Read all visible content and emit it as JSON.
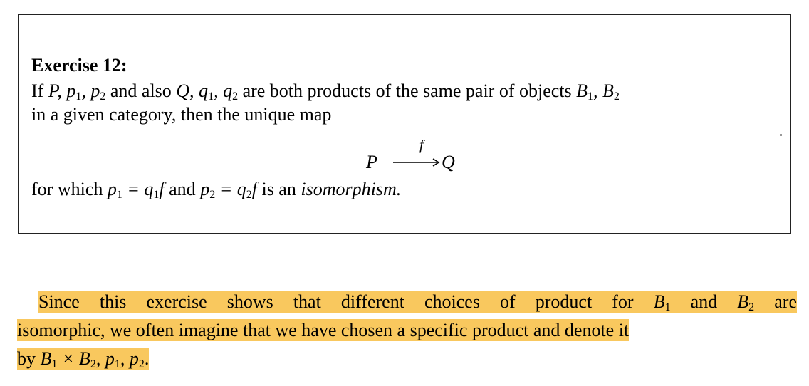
{
  "exercise": {
    "title": "Exercise 12:",
    "line1_a": "If ",
    "line1_b": "P, p",
    "line1_c": ", p",
    "line1_d": " and also ",
    "line1_e": "Q, q",
    "line1_f": ", q",
    "line1_g": " are both products of the same pair of objects ",
    "line1_h": "B",
    "line1_i": ", B",
    "sub1": "1",
    "sub2": "2",
    "line2": "in a given category, then the unique map",
    "map_source": "P",
    "map_label": "f",
    "map_target": "Q",
    "line4_a": "for which ",
    "line4_b": "p",
    "line4_c": " = q",
    "line4_d": "f",
    "line4_e": " and ",
    "line4_f": "p",
    "line4_g": " = q",
    "line4_h": "f",
    "line4_i": " is an ",
    "line4_j": "isomorphism."
  },
  "paragraph": {
    "p1_a": "Since this exercise shows that different choices of product for ",
    "p1_b": "B",
    "p1_c": " and ",
    "p1_d": "B",
    "p1_e": " are",
    "p2": "isomorphic, we often imagine that we have chosen a specific product and denote it",
    "p3_a": "by ",
    "p3_b": "B",
    "p3_c": " × B",
    "p3_d": ", p",
    "p3_e": ", p",
    "p3_f": ".",
    "highlight_color": "#f9c85e"
  }
}
